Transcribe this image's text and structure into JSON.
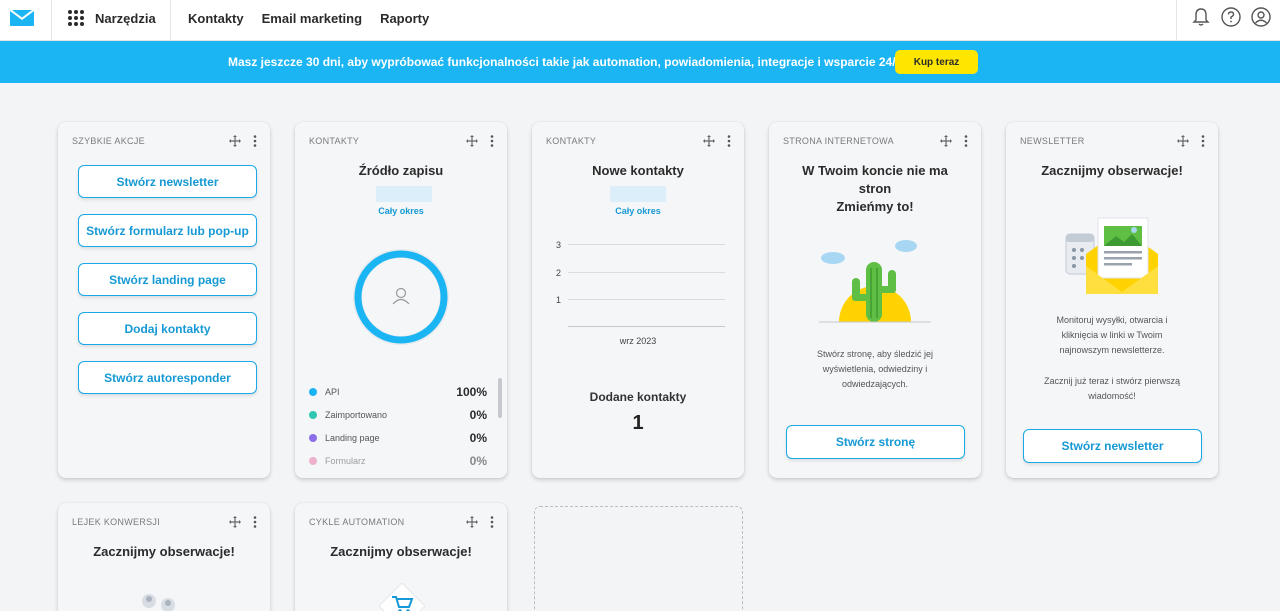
{
  "topbar": {
    "apps_label": "Narzędzia",
    "nav": [
      "Kontakty",
      "Email marketing",
      "Raporty"
    ],
    "icons": [
      "notifications-icon",
      "help-icon",
      "account-icon"
    ]
  },
  "banner": {
    "text_before": "Masz jeszcze ",
    "text_bold": "30 dni",
    "text_after": ", aby wypróbować funkcjonalności takie jak automation, powiadomienia, integracje i wsparcie 24/7.",
    "button": "Kup teraz",
    "color": "#1cb5f3",
    "button_color": "#ffe600"
  },
  "quick_actions": {
    "header": "SZYBKIE AKCJE",
    "buttons": [
      "Stwórz newsletter",
      "Stwórz formularz lub pop-up",
      "Stwórz landing page",
      "Dodaj kontakty",
      "Stwórz autoresponder"
    ]
  },
  "source": {
    "header": "KONTAKTY",
    "title": "Źródło zapisu",
    "period": "Cały okres",
    "legend": [
      {
        "label": "API",
        "value": "100%",
        "color": "#1cb5f3"
      },
      {
        "label": "Zaimportowano",
        "value": "0%",
        "color": "#2fc7b0"
      },
      {
        "label": "Landing page",
        "value": "0%",
        "color": "#8b6ee8"
      },
      {
        "label": "Formularz",
        "value": "0%",
        "color": "#e87aa7"
      }
    ]
  },
  "new_contacts": {
    "header": "KONTAKTY",
    "title": "Nowe kontakty",
    "period": "Cały okres",
    "y_ticks": [
      "3",
      "2",
      "1"
    ],
    "x_label": "wrz 2023",
    "added_label": "Dodane kontakty",
    "added_value": "1"
  },
  "website": {
    "header": "STRONA INTERNETOWA",
    "title_lines": [
      "W Twoim koncie nie ma",
      "stron",
      "Zmieńmy to!"
    ],
    "desc_lines": [
      "Stwórz stronę, aby śledzić jej",
      "wyświetlenia, odwiedziny i",
      "odwiedzających."
    ],
    "button": "Stwórz stronę"
  },
  "newsletter": {
    "header": "NEWSLETTER",
    "title": "Zacznijmy obserwacje!",
    "desc_lines": [
      "Monitoruj wysyłki, otwarcia i",
      "kliknięcia w linki w Twoim",
      "najnowszym newsletterze."
    ],
    "desc2_lines": [
      "Zacznij już teraz i stwórz pierwszą",
      "wiadomość!"
    ],
    "button": "Stwórz newsletter"
  },
  "funnel": {
    "header": "LEJEK KONWERSJI",
    "title": "Zacznijmy obserwacje!"
  },
  "automation": {
    "header": "CYKLE AUTOMATION",
    "title": "Zacznijmy obserwacje!"
  }
}
